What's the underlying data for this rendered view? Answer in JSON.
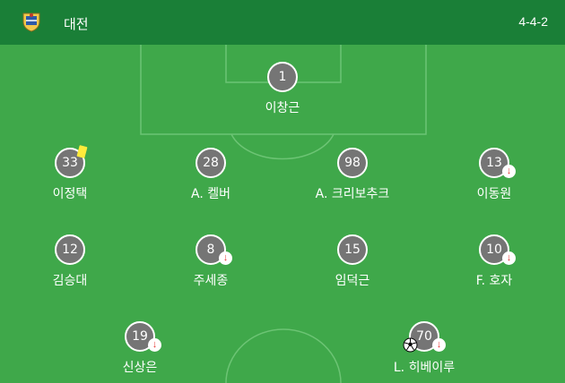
{
  "header": {
    "team_name": "대전",
    "formation": "4-4-2",
    "crest_icon": "team-crest-icon"
  },
  "colors": {
    "header_bg": "#1a7f37",
    "pitch": "#3fa84a",
    "player_circle": "#757575",
    "substitution_arrow": "#e53935",
    "yellow_card": "#ffeb3b"
  },
  "players": [
    {
      "number": "1",
      "name": "이창근",
      "events": []
    },
    {
      "number": "33",
      "name": "이정택",
      "events": [
        "yellow-card"
      ]
    },
    {
      "number": "28",
      "name": "A. 켈버",
      "events": []
    },
    {
      "number": "98",
      "name": "A. 크리보추크",
      "events": []
    },
    {
      "number": "13",
      "name": "이동원",
      "events": [
        "substitution-off"
      ]
    },
    {
      "number": "12",
      "name": "김승대",
      "events": []
    },
    {
      "number": "8",
      "name": "주세종",
      "events": [
        "substitution-off"
      ]
    },
    {
      "number": "15",
      "name": "임덕근",
      "events": []
    },
    {
      "number": "10",
      "name": "F. 호자",
      "events": [
        "substitution-off"
      ]
    },
    {
      "number": "19",
      "name": "신상은",
      "events": [
        "substitution-off"
      ]
    },
    {
      "number": "70",
      "name": "L. 히베이루",
      "events": [
        "goal",
        "substitution-off"
      ]
    }
  ]
}
